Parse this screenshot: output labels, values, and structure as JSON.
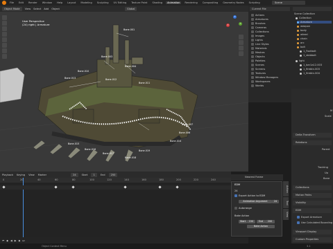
{
  "menu": {
    "items": [
      "File",
      "Edit",
      "Render",
      "Window",
      "Help"
    ],
    "workspaces": [
      "Layout",
      "Modeling",
      "Sculpting",
      "UV Editing",
      "Texture Paint",
      "Shading",
      "Animation",
      "Rendering",
      "Compositing",
      "Geometry Nodes",
      "Scripting"
    ],
    "active_workspace": "Animation",
    "scene": "Scene"
  },
  "viewport": {
    "mode": "Object Mode",
    "menus": [
      "View",
      "Select",
      "Add",
      "Object"
    ],
    "shading": "Global",
    "info_line1": "User Perspective",
    "info_line2": "(24) right | Armature",
    "bone_labels": [
      "Bone.001",
      "Bone.003",
      "Bone.004",
      "Bone.013",
      "Bone.010",
      "Bone.012",
      "Bone.011",
      "Bone.007",
      "Bone.006",
      "Bone.014",
      "Bone.019",
      "Bone.018",
      "Bone.017",
      "Bone.016",
      "Bone.015"
    ]
  },
  "outliner": {
    "title": "Current File",
    "items": [
      "Actions",
      "Armatures",
      "Brushes",
      "Cameras",
      "Collections",
      "Images",
      "Lights",
      "Line Styles",
      "Materials",
      "Meshes",
      "Objects",
      "Palettes",
      "Scenes",
      "Screens",
      "Textures",
      "Window Managers",
      "Workspaces",
      "Worlds"
    ]
  },
  "scene_collection": {
    "header": "Scene Collection",
    "items": [
      {
        "label": "Collection",
        "color": "#cccccc"
      },
      {
        "label": "Armature",
        "color": "#64b4ff"
      },
      {
        "label": "weapon",
        "color": "#e8a03c"
      },
      {
        "label": "body",
        "color": "#e8a03c"
      },
      {
        "label": "wheel",
        "color": "#e8a03c"
      },
      {
        "label": "chain",
        "color": "#e8a03c"
      },
      {
        "label": "arc",
        "color": "#e8a03c"
      },
      {
        "label": "bolt",
        "color": "#e8a03c"
      },
      {
        "label": "1_Footbolt",
        "color": "#cccccc"
      },
      {
        "label": "1_stabbolt",
        "color": "#cccccc"
      },
      {
        "label": "light",
        "color": "#cccccc"
      },
      {
        "label": "1_bar1a12.003",
        "color": "#cccccc"
      },
      {
        "label": "1_firebtn.003",
        "color": "#cccccc"
      },
      {
        "label": "1_firebtn.004",
        "color": "#cccccc"
      }
    ]
  },
  "timeline": {
    "menus": [
      "Playback",
      "Keying",
      "View",
      "Marker"
    ],
    "keying": "Keying",
    "start_label": "Start",
    "start": "1",
    "end_label": "End",
    "end": "250",
    "current_frame": "24",
    "ruler": [
      "0",
      "20",
      "40",
      "60",
      "80",
      "100",
      "120",
      "140",
      "160",
      "180",
      "200",
      "220",
      "240"
    ],
    "dope_header": [
      "Summary"
    ]
  },
  "export_panel": {
    "header": "Nearest Frame",
    "section": "EDM",
    "frame": "24",
    "export_action_label": "Export Action to EDM",
    "animation_argument": "Animation Argument",
    "anim_arg_value": "24",
    "autorange_label": "Autorange",
    "bake_section": "Bake Action",
    "bake_start": "Start",
    "bake_start_val": "150",
    "bake_end": "End",
    "bake_end_val": "200",
    "bake_button": "Bake Action",
    "tabs": [
      "Action",
      "Tool",
      "View"
    ]
  },
  "properties": {
    "sections": [
      "Delta Transform",
      "Relations",
      "Collections",
      "Motion Paths",
      "Visibility",
      "EDM",
      "Viewport Display",
      "Custom Properties"
    ],
    "edm_rows": [
      "Export Armature",
      "Use Calculated Bounding"
    ],
    "labels": [
      "Tracking",
      "Up",
      "Parent",
      "Bone"
    ]
  },
  "status": {
    "text": "Object Context Menu",
    "version": "3.1"
  }
}
